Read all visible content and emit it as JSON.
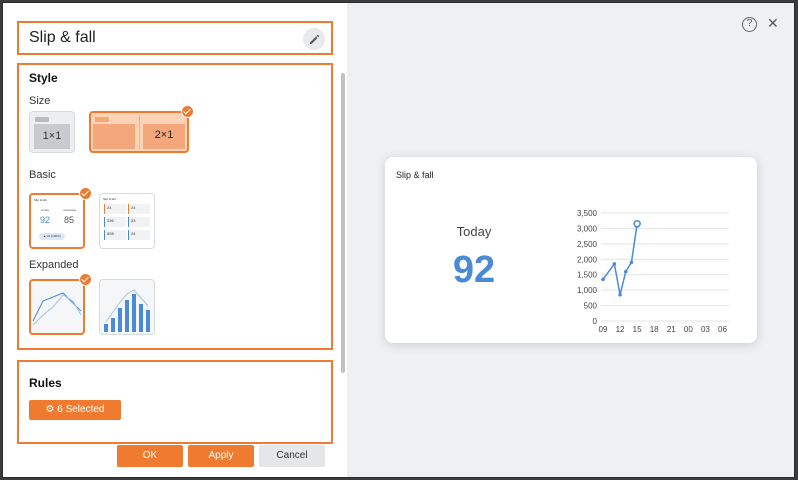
{
  "widget": {
    "title": "Slip & fall"
  },
  "style_section": {
    "heading": "Style",
    "size_label": "Size",
    "size_options": [
      {
        "label": "1×1",
        "selected": false
      },
      {
        "label": "2×1",
        "selected": true
      }
    ],
    "basic_label": "Basic",
    "basic_thumb": {
      "title": "Slip & fall",
      "today_label": "Today",
      "yesterday_label": "Yesterday",
      "today_value": "92",
      "yesterday_value": "85",
      "badge": "▲ 22 (100%)"
    },
    "basic_list_thumb": {
      "title": "Slip & fall",
      "values": [
        "24",
        "24",
        "336",
        "33",
        "508",
        "24"
      ]
    },
    "expanded_label": "Expanded"
  },
  "rules_section": {
    "heading": "Rules",
    "selected_button": "6 Selected"
  },
  "footer": {
    "ok": "OK",
    "apply": "Apply",
    "cancel": "Cancel"
  },
  "preview": {
    "title": "Slip & fall",
    "today_label": "Today",
    "today_value": "92"
  },
  "colors": {
    "accent": "#ee7b30",
    "series": "#4a8ad6"
  },
  "chart_data": {
    "type": "line",
    "x": [
      "09",
      "11",
      "12",
      "13",
      "14",
      "15"
    ],
    "values": [
      1350,
      1850,
      850,
      1600,
      1900,
      3150
    ],
    "xticks": [
      "09",
      "12",
      "15",
      "18",
      "21",
      "00",
      "03",
      "06"
    ],
    "yticks": [
      "0",
      "500",
      "1,000",
      "1,500",
      "2,000",
      "2,500",
      "3,000",
      "3,500"
    ],
    "ylim": [
      0,
      3500
    ],
    "grid": true
  }
}
